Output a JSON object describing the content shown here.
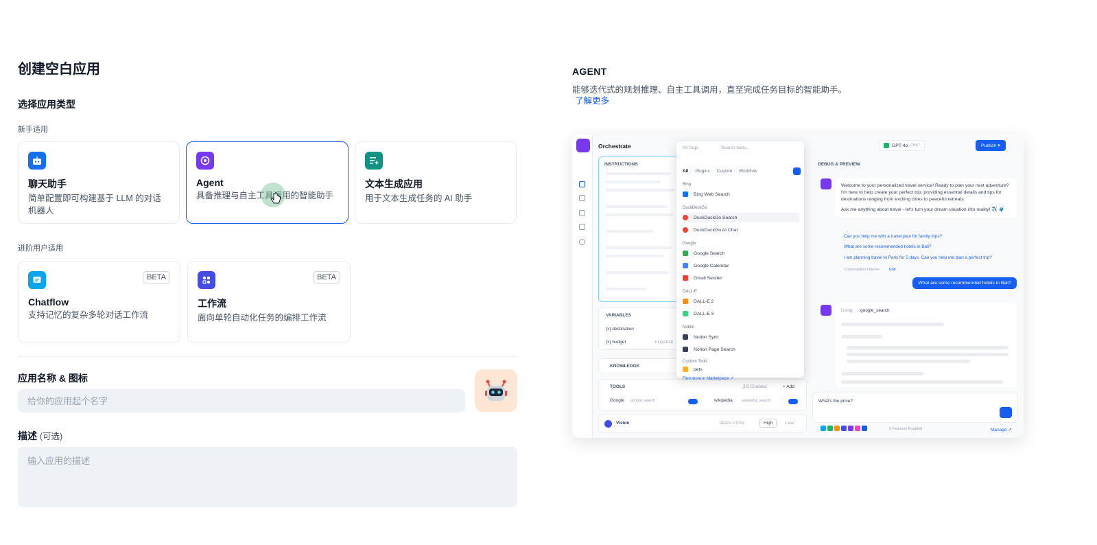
{
  "page": {
    "title": "创建空白应用",
    "section_title": "选择应用类型",
    "beginner_label": "新手适用",
    "advanced_label": "进阶用户适用"
  },
  "app_types": {
    "chatbot": {
      "name": "聊天助手",
      "desc": "简单配置即可构建基于 LLM 的对话机器人",
      "color": "#1570ef"
    },
    "agent": {
      "name": "Agent",
      "desc": "具备推理与自主工具调用的智能助手",
      "color": "#7839ee"
    },
    "completion": {
      "name": "文本生成应用",
      "desc": "用于文本生成任务的 AI 助手",
      "color": "#0e9384"
    },
    "chatflow": {
      "name": "Chatflow",
      "desc": "支持记忆的复杂多轮对话工作流",
      "badge": "BETA",
      "color": "#0ba5ec"
    },
    "workflow": {
      "name": "工作流",
      "desc": "面向单轮自动化任务的编排工作流",
      "badge": "BETA",
      "color": "#444ce7"
    }
  },
  "form": {
    "name_label": "应用名称 & 图标",
    "name_placeholder": "给你的应用起个名字",
    "desc_label": "描述",
    "desc_optional": "(可选)",
    "desc_placeholder": "输入应用的描述",
    "icon": "robot-icon"
  },
  "detail": {
    "title": "AGENT",
    "desc": "能够迭代式的规划推理、自主工具调用，直至完成任务目标的智能助手。",
    "learn_more": "了解更多"
  },
  "preview": {
    "header": "Orchestrate",
    "instructions": "INSTRUCTIONS",
    "variables": "VARIABLES",
    "var1": "{x} destination",
    "var2": "{x} budget",
    "var2_req": "REQUIRED",
    "knowledge": "KNOWLEDGE",
    "tools": "TOOLS",
    "tools_enabled": "2/2 Enabled",
    "tools_add": "+ Add",
    "tool1": "Google",
    "tool1_sub": "google_search",
    "tool2": "wikipedia",
    "tool2_sub": "wikipedia_search",
    "vision": "Vision",
    "resolution": "RESOLUTION",
    "high": "High",
    "low": "Low",
    "drop_all_tags": "All Tags",
    "drop_search": "Search tools...",
    "drop_tabs": [
      "All",
      "Plugins",
      "Custom",
      "Workflow"
    ],
    "grp_bing": "Bing",
    "bing_search": "Bing Web Search",
    "grp_ddg": "DuckDuckGo",
    "ddg_search": "DuckDuckGo Search",
    "ddg_chat": "DuckDuckGo AI Chat",
    "grp_google": "Google",
    "google_search": "Google Search",
    "google_calendar": "Google Calendar",
    "gmail": "Gmail Sender",
    "grp_dalle": "DALL-E",
    "dalle2": "DALL-E 2",
    "dalle3": "DALL-E 3",
    "grp_notion": "Notion",
    "notion_sync": "Notion Sync",
    "notion_search": "Notion Page Search",
    "grp_custom": "Custom Tools",
    "pets": "pets",
    "find_more": "Find more in Marketplace ↗",
    "model": "GPT-4o",
    "model_tag": "CHAT",
    "publish": "Publish ▾",
    "debug": "DEBUG & PREVIEW",
    "welcome": "Welcome to your personalized travel service! Ready to plan your next adventure? I'm here to help create your perfect trip, providing essential details and tips for destinations ranging from exciting cities to peaceful retreats.",
    "ask": "Ask me anything about travel - let's turn your dream vacation into reality! ✈️ 🧳",
    "q1": "Can you help me with a travel plan for family trips?",
    "q2": "What are some recommended hotels in Bali?",
    "q3": "I am planning travel to Paris for 5 days. Can you help me plan a perfect trip?",
    "opener": "Conversation Opener",
    "edit": "Edit",
    "user_msg": "What are some recommended hotels in Bali?",
    "using": "Using",
    "using_tool": "google_search",
    "input_text": "What's the price?",
    "features": "5 Features Enabled",
    "manage": "Manage ↗"
  }
}
